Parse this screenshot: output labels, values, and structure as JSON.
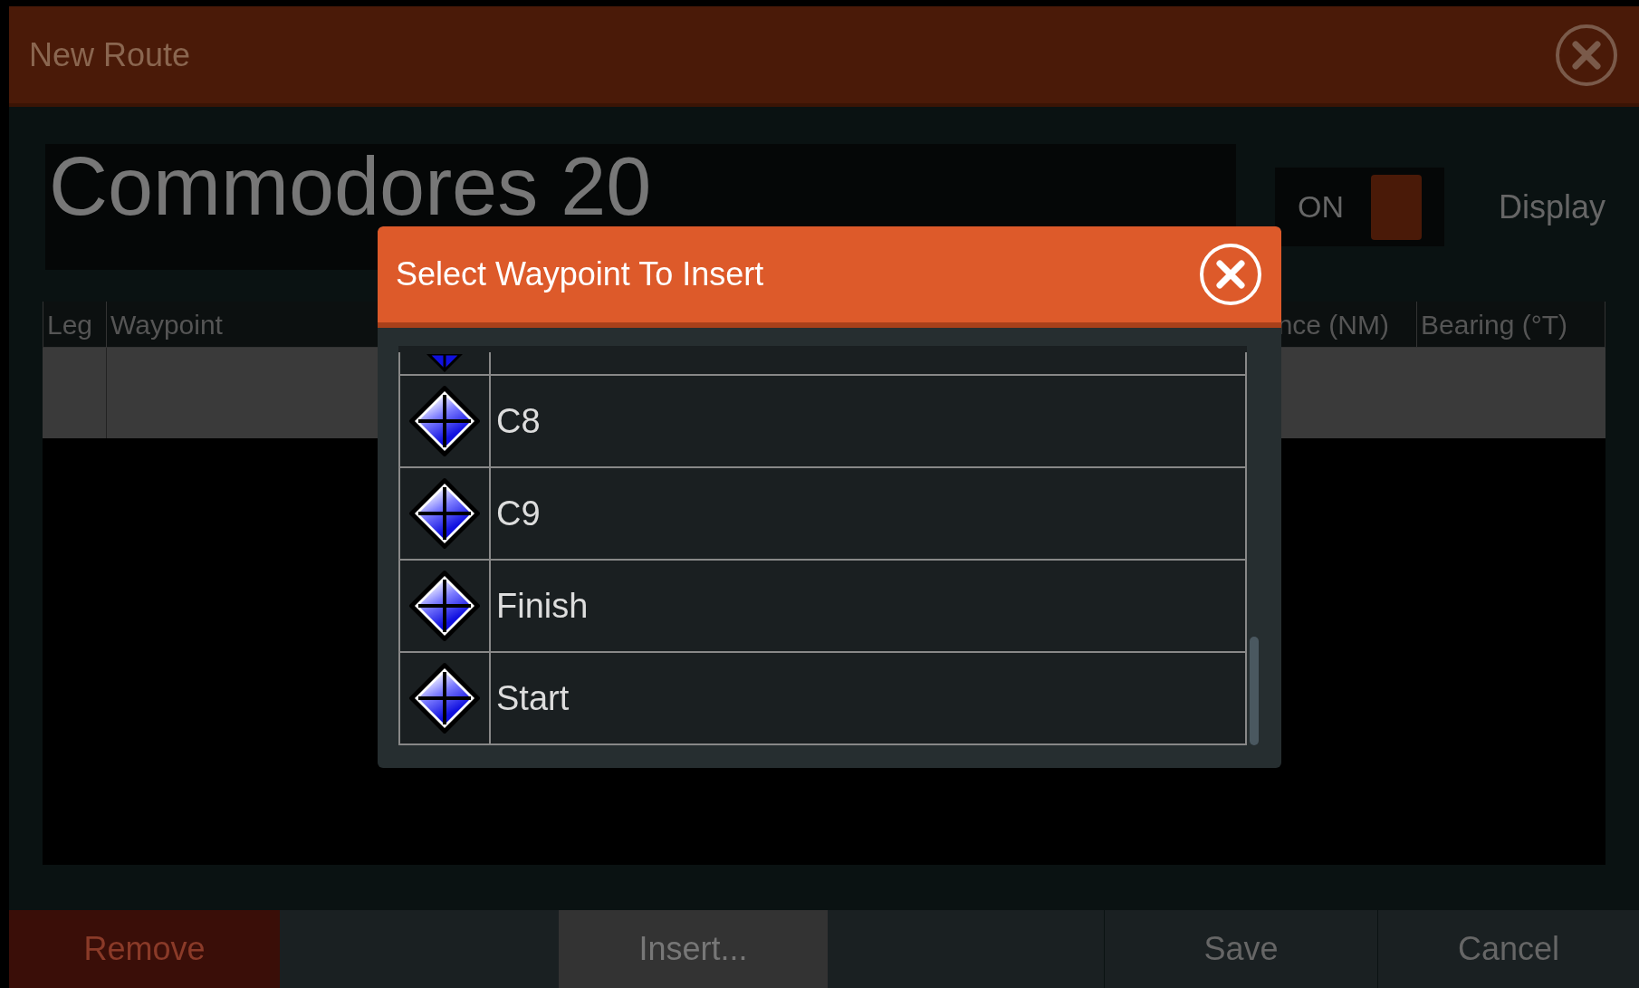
{
  "window": {
    "title": "New Route"
  },
  "route_name": {
    "value": "Commodores 20"
  },
  "display_toggle": {
    "label": "ON",
    "on": true
  },
  "display_label": "Display",
  "table": {
    "columns": [
      "Leg",
      "Waypoint",
      "nce (NM)",
      "Bearing (°T)"
    ]
  },
  "dialog": {
    "title": "Select Waypoint To Insert",
    "waypoints": [
      {
        "name": "C8"
      },
      {
        "name": "C9"
      },
      {
        "name": "Finish"
      },
      {
        "name": "Start"
      }
    ]
  },
  "buttons": [
    {
      "label": "Remove",
      "kind": "danger"
    },
    {
      "kind": "blank"
    },
    {
      "label": "Insert...",
      "kind": "active"
    },
    {
      "kind": "blank"
    },
    {
      "label": "Save",
      "kind": "normal"
    },
    {
      "label": "Cancel",
      "kind": "normal"
    }
  ]
}
